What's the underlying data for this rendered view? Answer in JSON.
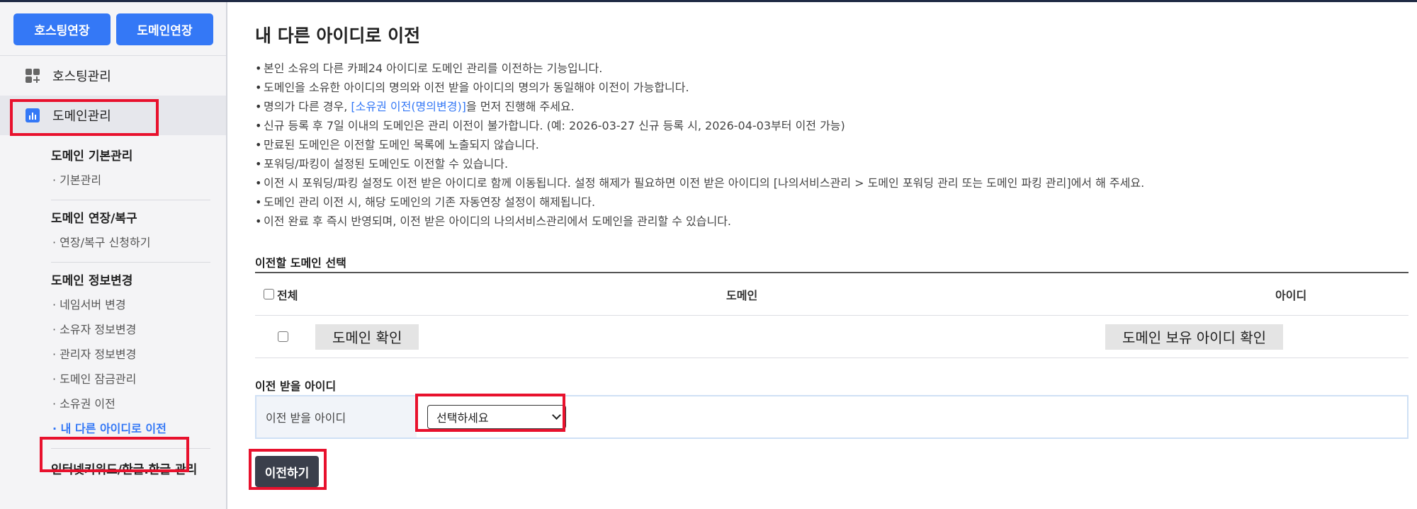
{
  "sidebar": {
    "top_buttons": {
      "hosting_renew": "호스팅연장",
      "domain_renew": "도메인연장"
    },
    "nav": {
      "hosting_mgmt": "호스팅관리",
      "domain_mgmt": "도메인관리"
    },
    "sections": [
      {
        "title": "도메인 기본관리",
        "items": [
          "· 기본관리"
        ]
      },
      {
        "title": "도메인 연장/복구",
        "items": [
          "· 연장/복구 신청하기"
        ]
      },
      {
        "title": "도메인 정보변경",
        "items": [
          "· 네임서버 변경",
          "· 소유자 정보변경",
          "· 관리자 정보변경",
          "· 도메인 잠금관리",
          "· 소유권 이전",
          "· 내 다른 아이디로 이전"
        ]
      },
      {
        "title": "인터넷키워드/한글.한글 관리",
        "items": []
      }
    ],
    "active_item": "· 내 다른 아이디로 이전"
  },
  "main": {
    "title": "내 다른 아이디로 이전",
    "notes": [
      "본인 소유의 다른 카페24 아이디로 도메인 관리를 이전하는 기능입니다.",
      "도메인을 소유한 아이디의 명의와 이전 받을 아이디의 명의가 동일해야 이전이 가능합니다.",
      {
        "before": "명의가 다른 경우, ",
        "link": "[소유권 이전(명의변경)]",
        "after": "을 먼저 진행해 주세요."
      },
      "신규 등록 후 7일 이내의 도메인은 관리 이전이 불가합니다. (예: 2026-03-27 신규 등록 시, 2026-04-03부터 이전 가능)",
      "만료된 도메인은 이전할 도메인 목록에 노출되지 않습니다.",
      "포워딩/파킹이 설정된 도메인도 이전할 수 있습니다.",
      "이전 시 포워딩/파킹 설정도 이전 받은 아이디로 함께 이동됩니다. 설정 해제가 필요하면 이전 받은 아이디의 [나의서비스관리 > 도메인 포워딩 관리 또는 도메인 파킹 관리]에서 해 주세요.",
      "도메인 관리 이전 시, 해당 도메인의 기존 자동연장 설정이 해제됩니다.",
      "이전 완료 후 즉시 반영되며, 이전 받은 아이디의 나의서비스관리에서 도메인을 관리할 수 있습니다."
    ],
    "select_section": {
      "title": "이전할 도메인 선택",
      "headers": {
        "all": "전체",
        "domain": "도메인",
        "id": "아이디"
      },
      "row": {
        "domain_btn": "도메인 확인",
        "id_btn": "도메인 보유 아이디 확인"
      }
    },
    "recv_section": {
      "title": "이전 받을 아이디",
      "label": "이전 받을 아이디",
      "select_value": "선택하세요"
    },
    "submit_label": "이전하기"
  }
}
